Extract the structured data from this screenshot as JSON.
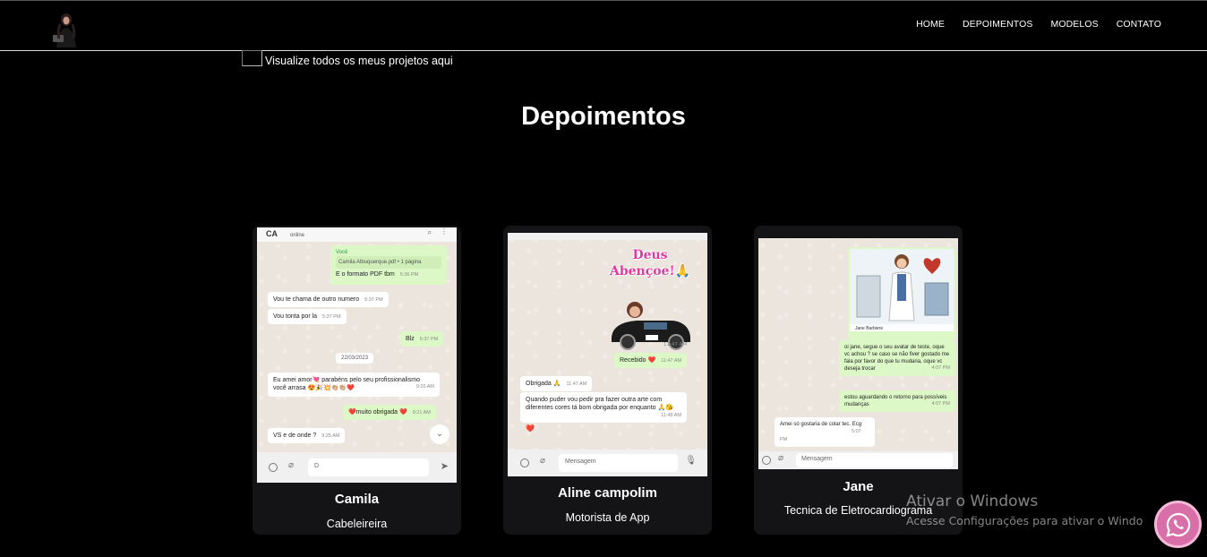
{
  "nav": {
    "items": [
      "HOME",
      "DEPOIMENTOS",
      "MODELOS",
      "CONTATO"
    ]
  },
  "projects_link": "Visualize todos os meus projetos aqui",
  "section_title": "Depoimentos",
  "testimonials": [
    {
      "name": "Camila",
      "role": "Cabeleireira",
      "chat": {
        "header_initials": "CA",
        "header_status": "online",
        "doc_sender": "Você",
        "doc_name": "Camila Albuquerque.pdf • 1 página",
        "msg1": "E o formato PDF tbm",
        "msg1_time": "5:36 PM",
        "msg2": "Vou te chama de outro numero",
        "msg2_time": "5:37 PM",
        "msg3": "Vou tonta por la",
        "msg3_time": "5:37 PM",
        "msg4": "Blz",
        "msg4_time": "5:37 PM",
        "date": "22/03/2023",
        "msg5": "Eu amei amor💘 parabéns pelo seu profissionalismo você arrasa 😍🎉💥👏🏼👏🏼❤️",
        "msg5_time": "9:20 AM",
        "msg6": "❤️muito obrigada ❤️",
        "msg6_time": "9:21 AM",
        "msg7": "VS e de onde ?",
        "msg7_time": "9:25 AM",
        "input_value": "D"
      }
    },
    {
      "name": "Aline campolim",
      "role": "Motorista de App",
      "chat": {
        "sticker_text": "Deus Abençoe!🙏",
        "time1": "11:47 AM",
        "msg1": "Recebido ❤️",
        "msg1_time": "11:47 AM",
        "msg2": "Obrigada 🙏",
        "msg2_time": "11:47 AM",
        "msg3": "Quando puder vou pedir pra fazer outra arte com diferentes cores tá bom obrigada por enquanto 🙏😘",
        "msg3_time": "11:48 AM",
        "reaction": "❤️",
        "input_placeholder": "Mensagem"
      }
    },
    {
      "name": "Jane",
      "role": "Tecnica de Eletrocardiograma",
      "chat": {
        "image_caption": "Jane Barbiere",
        "msg1": "oi jane, segue o seu avatar de teste, oque vc achou ? se caso se não fiver gostado me fala por favor do que tu mudaria, oque vc deseja trocar",
        "msg1_time": "4:07 PM",
        "msg2": "estou aguardando o retorno para possíveis mudanças",
        "msg2_time": "4:07 PM",
        "msg3": "Amei só gostaria de colar tec. Ecg",
        "msg3_time": "5:07 PM",
        "input_placeholder": "Mensagem"
      }
    }
  ],
  "watermark": {
    "line1": "Ativar o Windows",
    "line2": "Acesse Configurações para ativar o Windo"
  },
  "colors": {
    "background": "#000000",
    "card": "#141417",
    "whatsapp_button": "#d96fa8",
    "whatsapp_out_bubble": "#dcf8c6"
  }
}
